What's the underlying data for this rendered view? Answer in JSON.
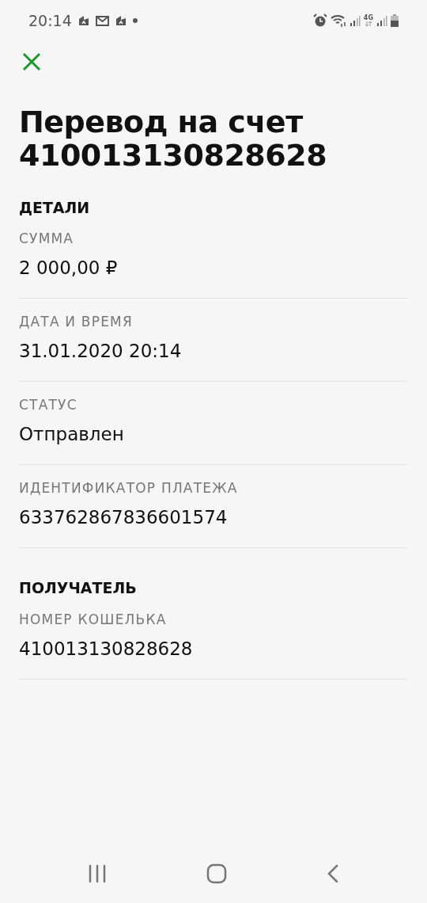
{
  "status_bar": {
    "time": "20:14",
    "network": "4G"
  },
  "title": "Перевод на счет 410013130828628",
  "sections": [
    {
      "heading": "ДЕТАЛИ",
      "fields": [
        {
          "label": "СУММА",
          "value": "2 000,00 ₽"
        },
        {
          "label": "ДАТА И ВРЕМЯ",
          "value": "31.01.2020 20:14"
        },
        {
          "label": "СТАТУС",
          "value": "Отправлен"
        },
        {
          "label": "ИДЕНТИФИКАТОР ПЛАТЕЖА",
          "value": "633762867836601574"
        }
      ]
    },
    {
      "heading": "ПОЛУЧАТЕЛЬ",
      "fields": [
        {
          "label": "НОМЕР КОШЕЛЬКА",
          "value": "410013130828628"
        }
      ]
    }
  ]
}
